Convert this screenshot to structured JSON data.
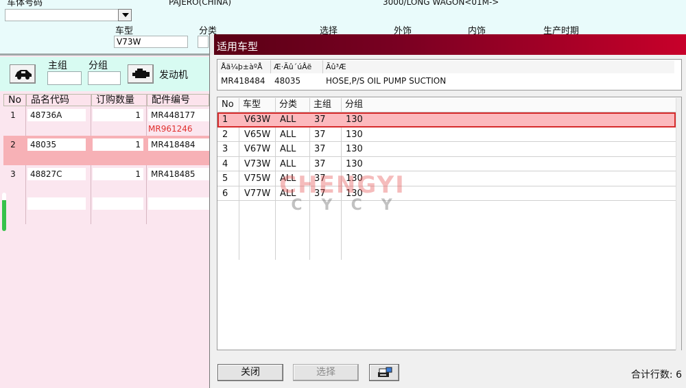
{
  "top": {
    "frame_label": "车体号码",
    "frame_value": "",
    "model_text": "PAJERO(CHINA)",
    "variant_text": "3000/LONG WAGON<01M->",
    "vehicle_type_label": "车型",
    "vehicle_type_value": "V73W",
    "category_label": "分类",
    "select_label": "选择",
    "exterior_label": "外饰",
    "interior_label": "内饰",
    "production_label": "生产时期"
  },
  "left": {
    "main_group_label": "主组",
    "sub_group_label": "分组",
    "engine_label": "发动机",
    "columns": [
      "No",
      "品名代码",
      "订购数量",
      "配件编号"
    ],
    "rows": [
      {
        "no": "1",
        "code": "48736A",
        "qty": "1",
        "part": "MR448177",
        "alt_part": "MR961246"
      },
      {
        "no": "2",
        "code": "48035",
        "qty": "1",
        "part": "MR418484",
        "alt_part": ""
      },
      {
        "no": "3",
        "code": "48827C",
        "qty": "1",
        "part": "MR418485",
        "alt_part": ""
      },
      {
        "no": "",
        "code": "",
        "qty": "",
        "part": "",
        "alt_part": ""
      }
    ]
  },
  "dialog": {
    "title": "适用车型",
    "info_headers": [
      "Åä¼þ±àºÅ",
      "Æ·Ãû´úÂë",
      "Ãû³Æ"
    ],
    "info_values": [
      "MR418484",
      "48035",
      "HOSE,P/S OIL PUMP SUCTION"
    ],
    "columns": [
      "No",
      "车型",
      "分类",
      "主组",
      "分组"
    ],
    "rows": [
      {
        "no": "1",
        "type": "V63W",
        "cat": "ALL",
        "main": "37",
        "sub": "130"
      },
      {
        "no": "2",
        "type": "V65W",
        "cat": "ALL",
        "main": "37",
        "sub": "130"
      },
      {
        "no": "3",
        "type": "V67W",
        "cat": "ALL",
        "main": "37",
        "sub": "130"
      },
      {
        "no": "4",
        "type": "V73W",
        "cat": "ALL",
        "main": "37",
        "sub": "130"
      },
      {
        "no": "5",
        "type": "V75W",
        "cat": "ALL",
        "main": "37",
        "sub": "130"
      },
      {
        "no": "6",
        "type": "V77W",
        "cat": "ALL",
        "main": "37",
        "sub": "130"
      }
    ],
    "selected_row": 1,
    "close_label": "关闭",
    "select_label": "选择",
    "count_label": "合计行数: 6"
  },
  "watermark": {
    "line1": "CHENGYI",
    "line2": "CYCY"
  },
  "icons": {
    "dropdown": "chevron-down-icon",
    "vehicle": "car-icon",
    "engine": "engine-icon",
    "print": "printer-icon"
  },
  "colors": {
    "title_bar": "#c8002a",
    "selected_row": "#fcb9bd",
    "highlight_row": "#f7b1b6",
    "alt_part": "#e0302e"
  }
}
